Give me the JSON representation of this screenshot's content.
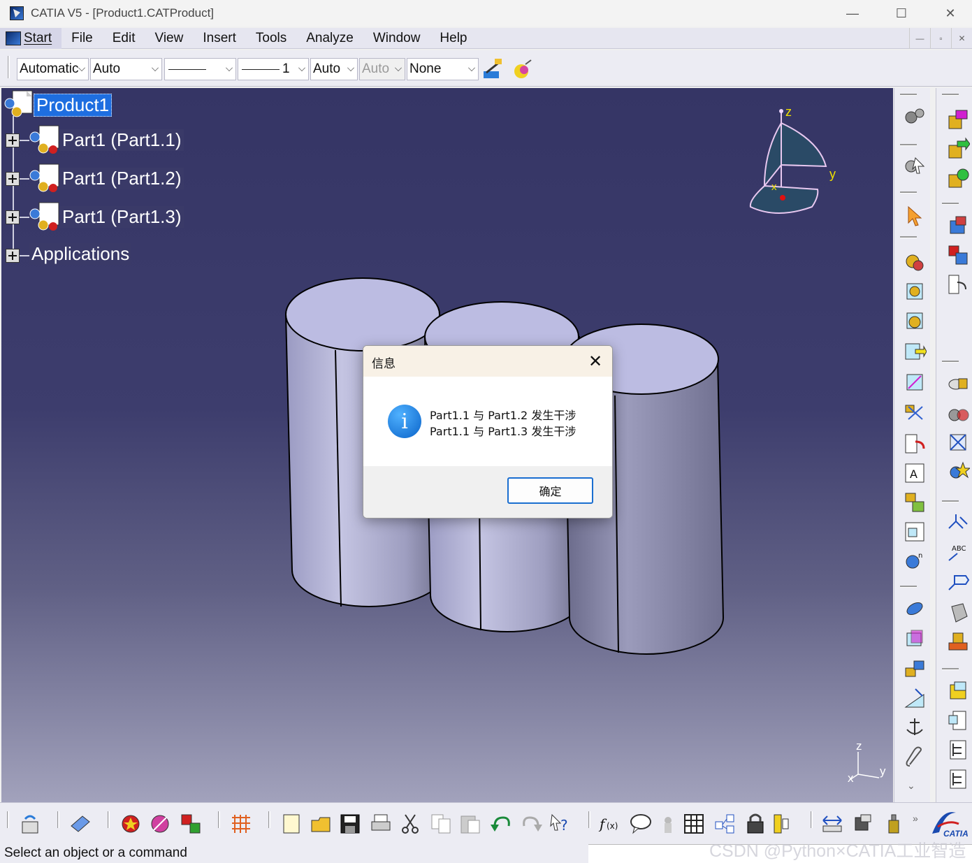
{
  "window": {
    "title": "CATIA V5 - [Product1.CATProduct]",
    "minimize": "—",
    "maximize": "☐",
    "close": "✕"
  },
  "menu": {
    "start": "Start",
    "items": [
      "File",
      "Edit",
      "View",
      "Insert",
      "Tools",
      "Analyze",
      "Window",
      "Help"
    ]
  },
  "graphic_properties": {
    "color": "Automatic",
    "transparency": "Auto",
    "linetype": "",
    "thickness": "1",
    "point_symbol": "Auto",
    "point_symbol_disabled": "Auto",
    "layer": "None"
  },
  "tree": {
    "root": "Product1",
    "children": [
      "Part1 (Part1.1)",
      "Part1 (Part1.2)",
      "Part1 (Part1.3)"
    ],
    "applications": "Applications"
  },
  "compass": {
    "z": "z",
    "y": "y",
    "x": "x"
  },
  "axis": {
    "z": "z",
    "y": "y",
    "x": "x"
  },
  "dialog": {
    "title": "信息",
    "messages": [
      "Part1.1 与 Part1.2 发生干涉",
      "Part1.1 与 Part1.3 发生干涉"
    ],
    "ok": "确定",
    "icon": "info-icon"
  },
  "status": {
    "text": "Select an object or a command"
  },
  "watermark": "CSDN @Python×CATIA工业智造",
  "colors": {
    "viewport_top": "#353565",
    "viewport_bottom": "#a2a2bc",
    "selection": "#1e6ee0",
    "cylinder": "#b8b8d8"
  }
}
